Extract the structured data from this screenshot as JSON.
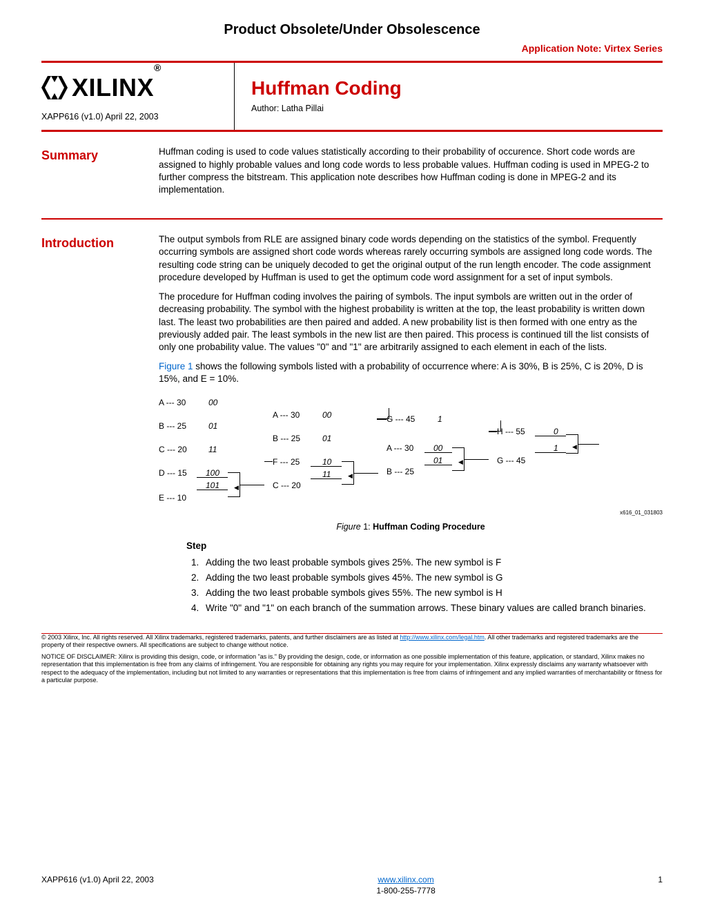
{
  "header": {
    "obsolete": "Product Obsolete/Under Obsolescence",
    "appnote": "Application Note: Virtex Series",
    "logo_text": "XILINX",
    "logo_reg": "®",
    "xapp": "XAPP616 (v1.0) April 22, 2003",
    "title": "Huffman Coding",
    "author": "Author: Latha Pillai"
  },
  "sections": {
    "summary": {
      "label": "Summary",
      "body": "Huffman coding is used to code values statistically according to their probability of occurence. Short code words are assigned to highly probable values and long code words to less probable values. Huffman coding is used in MPEG-2 to further compress the bitstream. This application note describes how Huffman coding is done in MPEG-2 and its implementation."
    },
    "introduction": {
      "label": "Introduction",
      "p1": "The output symbols from RLE are assigned binary code words depending on the statistics of the symbol. Frequently occurring symbols are assigned short code words whereas rarely occurring symbols are assigned long code words. The resulting code string can be uniquely decoded to get the original output of the run length encoder. The code assignment procedure developed by Huffman is used to get the optimum code word assignment for a set of input symbols.",
      "p2": "The procedure for Huffman coding involves the pairing of symbols. The input symbols are written out in the order of decreasing probability. The symbol with the highest probability is written at the top, the least probability is written down last. The least two probabilities are then paired and added. A new probability list is then formed with one entry as the previously added pair. The least symbols in the new list are then paired. This process is continued till the list consists of only one probability value. The values \"0\" and \"1\" are arbitrarily assigned to each element in each of the lists.",
      "p3a": "Figure 1",
      "p3b": " shows the following symbols listed with a probability of occurrence where: A is 30%, B is 25%, C is 20%, D is 15%, and E = 10%."
    }
  },
  "figure": {
    "caption_prefix": "Figure",
    "caption_num": "1:",
    "caption_title": "Huffman Coding Procedure",
    "id_label": "x616_01_031803",
    "col1": {
      "A": "A --- 30",
      "Ac": "00",
      "B": "B --- 25",
      "Bc": "01",
      "C": "C --- 20",
      "Cc": "11",
      "D": "D --- 15",
      "Dc": "100",
      "E": "E --- 10",
      "Ec": "101"
    },
    "col2": {
      "A": "A --- 30",
      "Ac": "00",
      "B": "B --- 25",
      "Bc": "01",
      "F": "F --- 25",
      "Fc": "10",
      "C": "C --- 20",
      "Cc": "11"
    },
    "col3": {
      "G": "G --- 45",
      "Gc": "1",
      "A": "A --- 30",
      "Ac": "00",
      "B": "B --- 25",
      "Bc": "01"
    },
    "col4": {
      "H": "H --- 55",
      "Hc": "0",
      "G": "G --- 45",
      "Gc": "1"
    }
  },
  "steps": {
    "head": "Step",
    "s1": "Adding the two least probable symbols gives 25%. The new symbol is F",
    "s2": "Adding the two least probable symbols gives 45%. The new symbol is G",
    "s3": "Adding the two least probable symbols gives 55%. The new symbol is H",
    "s4": "Write \"0\" and \"1\" on each branch of the summation arrows. These binary values are called branch binaries."
  },
  "legal": {
    "p1a": "© 2003 Xilinx, Inc. All rights reserved. All Xilinx trademarks, registered trademarks, patents, and further disclaimers are as listed at ",
    "p1link": "http://www.xilinx.com/legal.htm",
    "p1b": ". All other trademarks and registered trademarks are the property of their respective owners. All specifications are subject to change without notice.",
    "p2": "NOTICE OF DISCLAIMER: Xilinx is providing this design, code, or information \"as is.\" By providing the design, code, or information as one possible implementation of this feature, application, or standard, Xilinx makes no representation that this implementation is free from any claims of infringement. You are responsible for obtaining any rights you may require for your implementation. Xilinx expressly disclaims any warranty whatsoever with respect to the adequacy of the implementation, including but not limited to any warranties or representations that this implementation is free from claims of infringement and any implied warranties of merchantability or fitness for a particular purpose."
  },
  "footer": {
    "left": "XAPP616 (v1.0) April 22, 2003",
    "link": "www.xilinx.com",
    "phone": "1-800-255-7778",
    "page": "1"
  }
}
